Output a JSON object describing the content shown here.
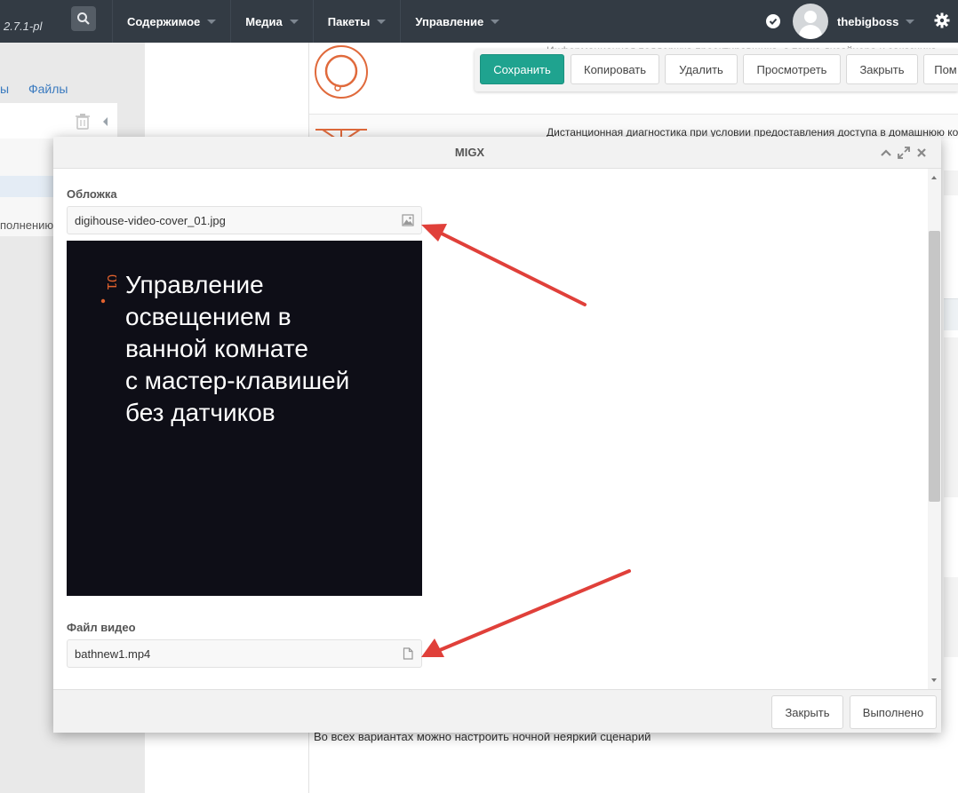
{
  "header": {
    "version": "2.7.1-pl",
    "nav": [
      "Содержимое",
      "Медиа",
      "Пакеты",
      "Управление"
    ],
    "username": "thebigboss"
  },
  "left_panel": {
    "tab_fragment": "ы",
    "tab_files": "Файлы",
    "tree_text_fragment": "полнению"
  },
  "content": {
    "desc1": "Информационная поддержка проектировщика, а также дизайнера и заказчика",
    "desc2": "Дистанционная диагностика при условии предоставления доступа в домашнюю ко",
    "bottom_text": "Во всех вариантах можно настроить ночной неяркий сценарий"
  },
  "actions": {
    "save": "Сохранить",
    "copy": "Копировать",
    "delete": "Удалить",
    "view": "Просмотреть",
    "close": "Закрыть",
    "help": "Пом"
  },
  "modal": {
    "title": "MIGX",
    "cover_label": "Обложка",
    "cover_value": "digihouse-video-cover_01.jpg",
    "preview_number": "01",
    "preview_text": "Управление\nосвещением в\nванной комнате\nс мастер-клавишей\nбез датчиков",
    "video_label": "Файл видео",
    "video_value": "bathnew1.mp4",
    "close_btn": "Закрыть",
    "done_btn": "Выполнено"
  },
  "colors": {
    "topbar": "#333b44",
    "primary_button": "#1fa38f",
    "accent_orange": "#e06a3c",
    "arrow_red": "#e0403a"
  }
}
